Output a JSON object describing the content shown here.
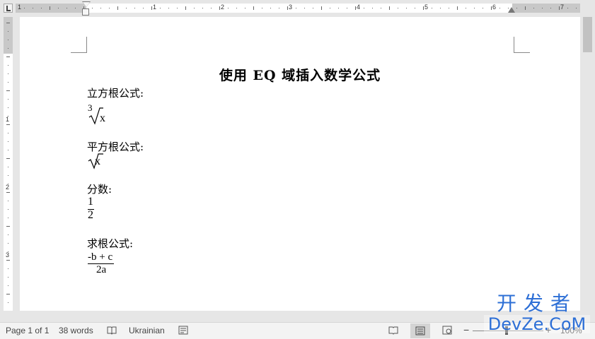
{
  "ruler": {
    "numbers": [
      "1",
      "1",
      "2",
      "3",
      "4",
      "5",
      "6",
      "7"
    ],
    "left_numbers": [
      "1",
      "2",
      "3"
    ]
  },
  "document": {
    "title": "使用 EQ 域插入数学公式",
    "sections": [
      {
        "label": "立方根公式:",
        "index": "3",
        "radicand": "x"
      },
      {
        "label": "平方根公式:",
        "radicand": "x"
      },
      {
        "label": "分数:",
        "numerator": "1",
        "denominator": "2"
      },
      {
        "label": "求根公式:",
        "numerator": "-b + c",
        "denominator": "2a"
      }
    ]
  },
  "statusbar": {
    "page": "Page 1 of 1",
    "words": "38 words",
    "language": "Ukrainian",
    "zoom": "100%"
  },
  "watermark": {
    "cn": "开发者",
    "en": "DevZe.CoM"
  },
  "colors": {
    "watermark": "#2d6fd6",
    "chrome": "#e6e6e6",
    "page": "#ffffff"
  }
}
